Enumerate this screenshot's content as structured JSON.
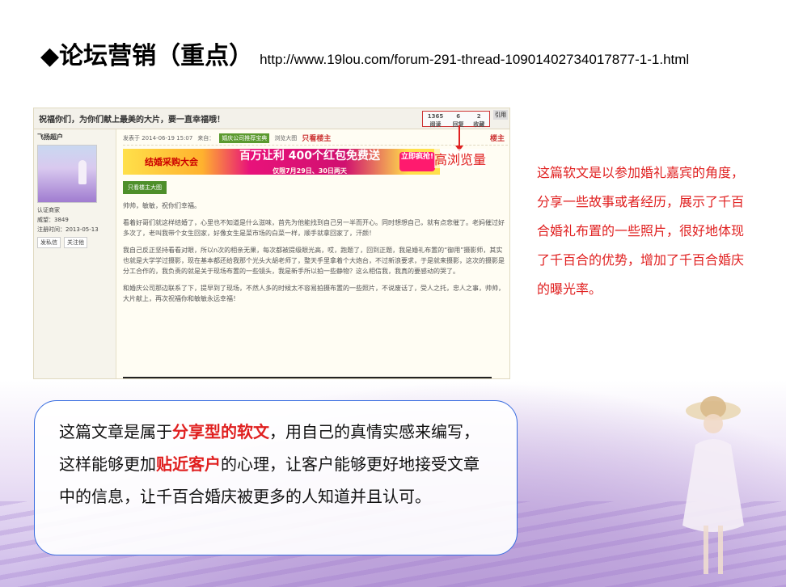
{
  "title": {
    "main": "◆论坛营销（重点）",
    "url": "http://www.19lou.com/forum-291-thread-10901402734017877-1-1.html"
  },
  "forum": {
    "top_text": "祝福你们，为你们献上最美的大片，要一直幸福哦！",
    "stats": {
      "views_num": "1365",
      "views_label": "阅读",
      "replies_num": "6",
      "replies_label": "回复",
      "favs_num": "2",
      "favs_label": "收藏"
    },
    "corner_tag": "引用",
    "user": {
      "name": "飞扬超户",
      "badge": "认证商家",
      "prestige": "威望：3849",
      "register": "注册时间：2013-05-13",
      "msg_btn": "发私信",
      "follow_btn": "关注他"
    },
    "meta": {
      "time": "发表于 2014-06-19 15:07",
      "source": "来自：",
      "tag": "婚庆公司推荐宝典",
      "link": "浏览大图",
      "only_host": "只看楼主",
      "louzhu": "楼主"
    },
    "banner": {
      "left": "结婚采购大会",
      "middle": "百万让利 400个红包免费送",
      "sub": "仅限7月29日、30日两天",
      "right": "立即疯抢!"
    },
    "green_btn": "只看楼主大图",
    "paragraphs": [
      "帅帅，敏敏，祝你们幸福。",
      "看着好哥们就这样结婚了，心里也不知道是什么滋味，首先为他能找到自己另一半而开心。同时想想自己，就有点悲催了。老妈催过好多次了，老叫我带个女生回家，好像女生是菜市场的白菜一样，顺手就拿回家了，汗颜！",
      "我自己反正坚持看看对眼，所以n次的相亲无果，每次都被提级眼光高，哎，跑题了，回到正题，我是婚礼布置的“御用”摄影师，其实也就是大学学过摄影，现在基本都还给我那个光头大胡老师了，整天手里拿着个大炮台，不过新浪要求，于是就来摄影，这次的摄影是分工合作的，我负责的就是关于现场布置的一些镜头，我是新手所以拍一些静物？这么相信我，我真的要感动的哭了。",
      "和婚庆公司那边联系了下，提早到了现场，不然人多的时候太不容易拍摄布置的一些照片，不说废话了，受人之托，忠人之事，帅帅，大片献上，再次祝福你和敏敏永远幸福！"
    ]
  },
  "annotation": "高浏览量",
  "right_note": "这篇软文是以参加婚礼嘉宾的角度，分享一些故事或者经历，展示了千百合婚礼布置的一些照片，很好地体现了千百合的优势，增加了千百合婚庆的曝光率。",
  "summary": {
    "part1": "这篇文章是属于",
    "hl1": "分享型的软文",
    "part2": "，用自己的真情实感来编写，这样能够更加",
    "hl2": "贴近客户",
    "part3": "的心理，让客户能够更好地接受文章中的信息，让千百合婚庆被更多的人知道并且认可。"
  },
  "colors": {
    "highlight": "#e02020",
    "box_border": "#3a6ee0"
  }
}
